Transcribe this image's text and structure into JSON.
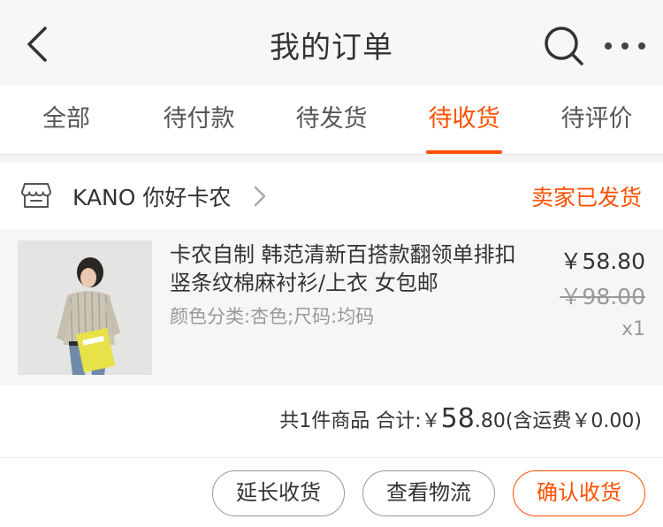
{
  "nav": {
    "title": "我的订单",
    "back_icon": "chevron-left-icon",
    "search_icon": "search-icon",
    "more_icon": "more-icon"
  },
  "tabs": [
    {
      "label": "全部",
      "active": false
    },
    {
      "label": "待付款",
      "active": false
    },
    {
      "label": "待发货",
      "active": false
    },
    {
      "label": "待收货",
      "active": true
    },
    {
      "label": "待评价",
      "active": false
    }
  ],
  "order": {
    "shop": {
      "icon": "store-icon",
      "name": "KANO 你好卡农",
      "status": "卖家已发货"
    },
    "item": {
      "title": "卡农自制 韩范清新百搭款翻领单排扣竖条纹棉麻衬衫/上衣 女包邮",
      "sku": "颜色分类:杏色;尺码:均码",
      "price": "￥58.80",
      "original_price": "￥98.00",
      "quantity": "x1"
    },
    "summary": {
      "count_text": "共1件商品 合计:￥",
      "total_int": "58",
      "total_dec": ".80",
      "shipping_text": "(含运费￥0.00)"
    },
    "actions": {
      "extend": "延长收货",
      "logistics": "查看物流",
      "confirm": "确认收货"
    }
  },
  "colors": {
    "accent": "#ff5000",
    "text": "#333333",
    "muted": "#999999"
  }
}
